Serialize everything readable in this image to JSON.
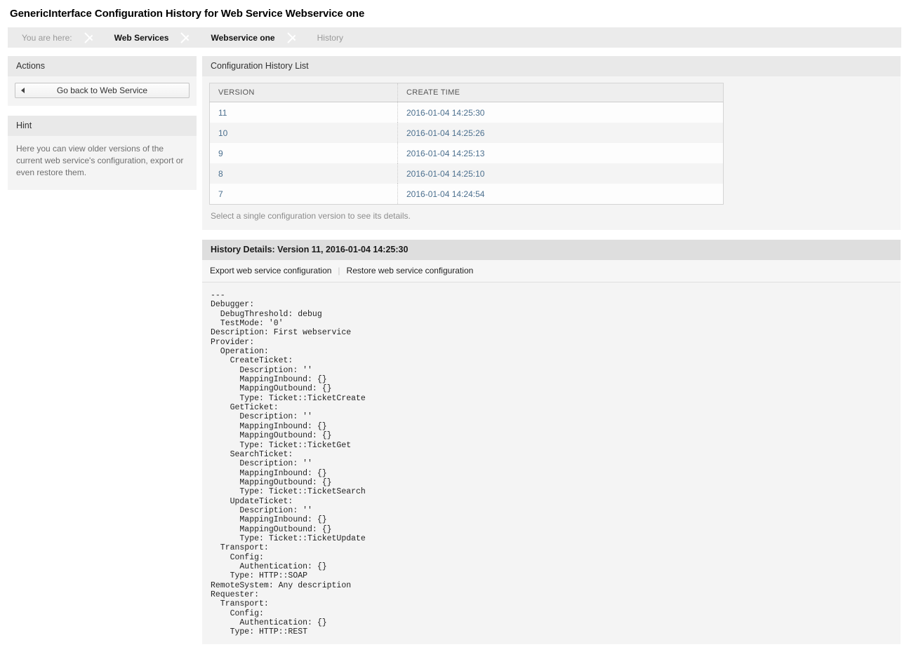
{
  "page": {
    "title": "GenericInterface Configuration History for Web Service Webservice one"
  },
  "breadcrumb": {
    "prefix": "You are here:",
    "items": [
      {
        "label": "Web Services",
        "state": "link"
      },
      {
        "label": "Webservice one",
        "state": "link"
      },
      {
        "label": "History",
        "state": "current"
      }
    ]
  },
  "sidebar": {
    "actions": {
      "header": "Actions",
      "back_button": "Go back to Web Service",
      "back_icon": "caret-left-icon"
    },
    "hint": {
      "header": "Hint",
      "text": "Here you can view older versions of the current web service's configuration, export or even restore them."
    }
  },
  "history_list": {
    "header": "Configuration History List",
    "columns": [
      "VERSION",
      "CREATE TIME"
    ],
    "rows": [
      {
        "version": "11",
        "create_time": "2016-01-04 14:25:30"
      },
      {
        "version": "10",
        "create_time": "2016-01-04 14:25:26"
      },
      {
        "version": "9",
        "create_time": "2016-01-04 14:25:13"
      },
      {
        "version": "8",
        "create_time": "2016-01-04 14:25:10"
      },
      {
        "version": "7",
        "create_time": "2016-01-04 14:24:54"
      }
    ],
    "note": "Select a single configuration version to see its details."
  },
  "history_details": {
    "header": "History Details: Version 11, 2016-01-04 14:25:30",
    "export_link": "Export web service configuration",
    "restore_link": "Restore web service configuration",
    "separator": "|",
    "yaml": "---\nDebugger:\n  DebugThreshold: debug\n  TestMode: '0'\nDescription: First webservice\nProvider:\n  Operation:\n    CreateTicket:\n      Description: ''\n      MappingInbound: {}\n      MappingOutbound: {}\n      Type: Ticket::TicketCreate\n    GetTicket:\n      Description: ''\n      MappingInbound: {}\n      MappingOutbound: {}\n      Type: Ticket::TicketGet\n    SearchTicket:\n      Description: ''\n      MappingInbound: {}\n      MappingOutbound: {}\n      Type: Ticket::TicketSearch\n    UpdateTicket:\n      Description: ''\n      MappingInbound: {}\n      MappingOutbound: {}\n      Type: Ticket::TicketUpdate\n  Transport:\n    Config:\n      Authentication: {}\n    Type: HTTP::SOAP\nRemoteSystem: Any description\nRequester:\n  Transport:\n    Config:\n      Authentication: {}\n    Type: HTTP::REST"
  },
  "colors": {
    "link": "#4b6f8e",
    "widget_bg": "#f4f4f4",
    "header_bg": "#e9e9e9",
    "detail_header_bg": "#dedede"
  }
}
